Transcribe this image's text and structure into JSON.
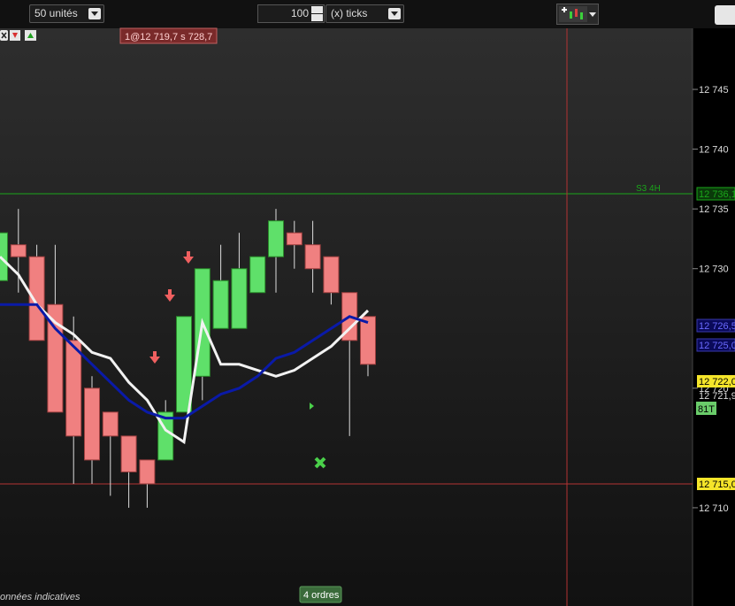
{
  "toolbar": {
    "units_select": "50 unités",
    "ticks_value": "100",
    "ticks_unit_select": "(x) ticks"
  },
  "chart": {
    "order_label": "1@12 719,7 s 728,7",
    "s3_label": "S3 4H",
    "footer_note": "onnées indicatives",
    "orders_badge": "4 ordres",
    "marker_81t": "81T",
    "price_ticks": [
      "12 745",
      "12 740",
      "12 735",
      "12 730",
      "12 720",
      "12 710"
    ],
    "price_tags": {
      "s3": "12 736,1",
      "ma1": "12 726,5",
      "ma2": "12 725,0",
      "sell": "12 722,0",
      "last": "12 721,9",
      "cross": "12 715,0"
    },
    "colors": {
      "bull": "#5fe06a",
      "bear": "#f08080",
      "ma_white": "#f2f2f2",
      "ma_blue": "#0a1aa8",
      "s3": "#1aa61a",
      "crosshair": "#b33333"
    }
  },
  "chart_data": {
    "type": "candlestick",
    "ylim": [
      12704,
      12749
    ],
    "candles": [
      {
        "o": 12729,
        "h": 12733,
        "l": 12729,
        "c": 12733
      },
      {
        "o": 12732,
        "h": 12735,
        "l": 12728,
        "c": 12731
      },
      {
        "o": 12731,
        "h": 12732,
        "l": 12724,
        "c": 12724
      },
      {
        "o": 12727,
        "h": 12732,
        "l": 12718,
        "c": 12718
      },
      {
        "o": 12724,
        "h": 12726,
        "l": 12712,
        "c": 12716
      },
      {
        "o": 12720,
        "h": 12721,
        "l": 12712,
        "c": 12714
      },
      {
        "o": 12718,
        "h": 12718,
        "l": 12711,
        "c": 12716
      },
      {
        "o": 12716,
        "h": 12716,
        "l": 12710,
        "c": 12713
      },
      {
        "o": 12714,
        "h": 12714,
        "l": 12710,
        "c": 12712
      },
      {
        "o": 12714,
        "h": 12719,
        "l": 12714,
        "c": 12718
      },
      {
        "o": 12718,
        "h": 12722,
        "l": 12718,
        "c": 12726
      },
      {
        "o": 12721,
        "h": 12729,
        "l": 12719,
        "c": 12730
      },
      {
        "o": 12725,
        "h": 12732,
        "l": 12725,
        "c": 12729
      },
      {
        "o": 12725,
        "h": 12733,
        "l": 12725,
        "c": 12730
      },
      {
        "o": 12728,
        "h": 12731,
        "l": 12728,
        "c": 12731
      },
      {
        "o": 12731,
        "h": 12735,
        "l": 12728,
        "c": 12734
      },
      {
        "o": 12733,
        "h": 12734,
        "l": 12730,
        "c": 12732
      },
      {
        "o": 12732,
        "h": 12734,
        "l": 12728,
        "c": 12730
      },
      {
        "o": 12731,
        "h": 12731,
        "l": 12727,
        "c": 12728
      },
      {
        "o": 12728,
        "h": 12728,
        "l": 12716,
        "c": 12724
      },
      {
        "o": 12726,
        "h": 12726,
        "l": 12721,
        "c": 12722
      }
    ],
    "ma_white": [
      12731,
      12729.5,
      12727,
      12725.5,
      12724.5,
      12723,
      12722.5,
      12720.5,
      12719,
      12716.5,
      12715.5,
      12725.5,
      12722,
      12722,
      12721.5,
      12721,
      12721.5,
      12722.5,
      12723.5,
      12725,
      12726.5
    ],
    "ma_blue": [
      12727,
      12727,
      12727,
      12725,
      12723.5,
      12722,
      12720.5,
      12719,
      12718,
      12717.5,
      12717.5,
      12718.5,
      12719.5,
      12720,
      12721,
      12722.5,
      12723,
      12724,
      12725,
      12726,
      12725.5
    ]
  }
}
